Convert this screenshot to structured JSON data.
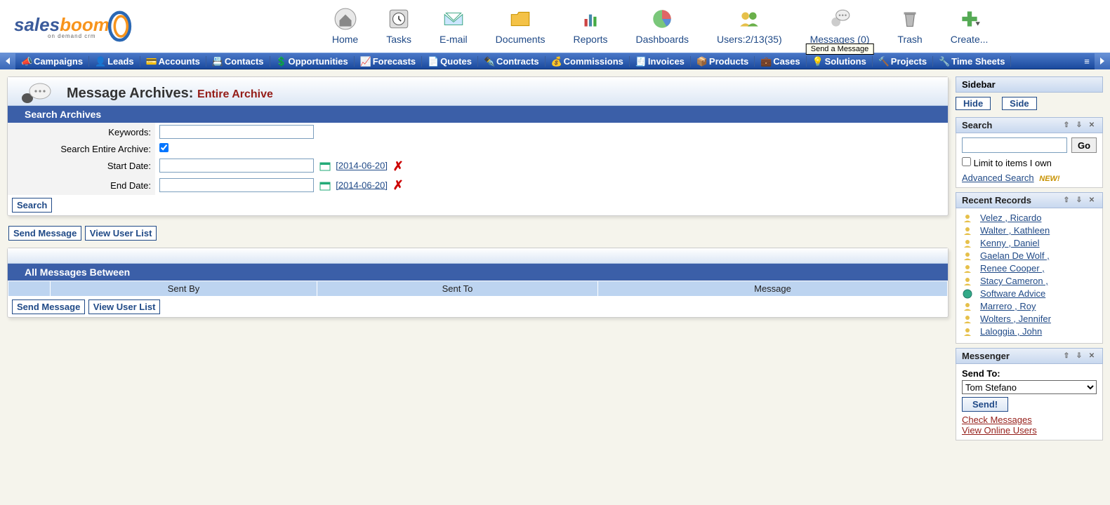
{
  "top_nav": {
    "items": [
      {
        "label": "Home"
      },
      {
        "label": "Tasks"
      },
      {
        "label": "E-mail"
      },
      {
        "label": "Documents"
      },
      {
        "label": "Reports"
      },
      {
        "label": "Dashboards"
      },
      {
        "label": "Users:2/13(35)"
      },
      {
        "label": "Messages (0)"
      },
      {
        "label": "Trash"
      },
      {
        "label": "Create..."
      }
    ],
    "tooltip": "Send a Message"
  },
  "main_nav": {
    "items": [
      "Campaigns",
      "Leads",
      "Accounts",
      "Contacts",
      "Opportunities",
      "Forecasts",
      "Quotes",
      "Contracts",
      "Commissions",
      "Invoices",
      "Products",
      "Cases",
      "Solutions",
      "Projects",
      "Time Sheets"
    ]
  },
  "page": {
    "title": "Message Archives:",
    "subtitle": "Entire Archive",
    "search_header": "Search Archives",
    "labels": {
      "keywords": "Keywords:",
      "entire": "Search Entire Archive:",
      "start": "Start Date:",
      "end": "End Date:"
    },
    "values": {
      "keywords": "",
      "start": "",
      "end": "",
      "start_link": "[2014-06-20]",
      "end_link": "[2014-06-20]",
      "entire_checked": true
    },
    "buttons": {
      "search": "Search",
      "send_message": "Send Message",
      "view_user_list": "View User List"
    },
    "msg_section_header": "All Messages Between",
    "msg_columns": {
      "sent_by": "Sent By",
      "sent_to": "Sent To",
      "message": "Message"
    }
  },
  "sidebar": {
    "title": "Sidebar",
    "hide": "Hide",
    "side": "Side",
    "search": {
      "title": "Search",
      "go": "Go",
      "limit": "Limit to items I own",
      "advanced": "Advanced Search",
      "new_badge": "NEW!"
    },
    "recent": {
      "title": "Recent Records",
      "items": [
        "Velez , Ricardo",
        "Walter , Kathleen",
        "Kenny , Daniel",
        "Gaelan De Wolf ,",
        "Renee Cooper ,",
        "Stacy Cameron ,",
        "Software Advice",
        "Marrero , Roy",
        "Wolters , Jennifer",
        "Laloggia , John"
      ]
    },
    "messenger": {
      "title": "Messenger",
      "send_to_label": "Send To:",
      "selected": "Tom Stefano",
      "send_btn": "Send!",
      "check": "Check Messages",
      "online": "View Online Users"
    }
  }
}
